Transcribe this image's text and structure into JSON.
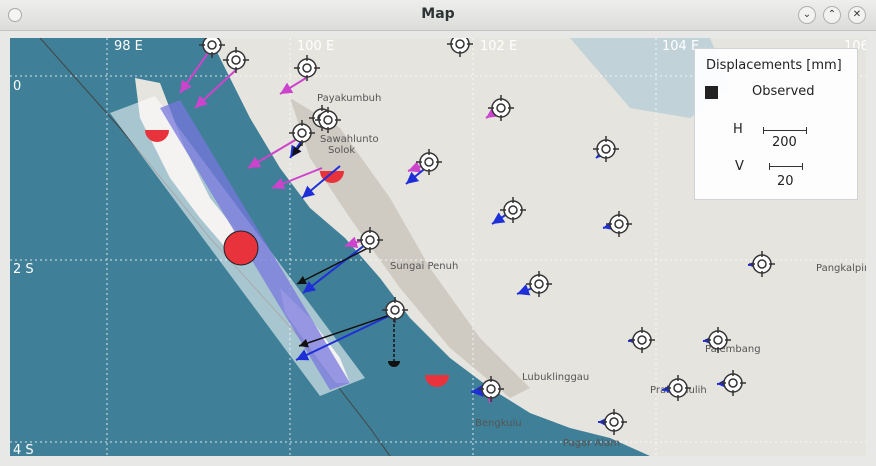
{
  "window": {
    "title": "Map"
  },
  "titlebar_icons": [
    "minimize-icon",
    "maximize-icon",
    "close-icon"
  ],
  "axes": {
    "lon_labels": [
      "98 E",
      "100 E",
      "102 E",
      "104 E",
      "106"
    ],
    "lat_labels": [
      "0",
      "2 S",
      "4 S"
    ]
  },
  "places": [
    "Payakumbuh",
    "Sawahlunto",
    "Solok",
    "Sungai Penuh",
    "Lubuklinggau",
    "Bengkulu",
    "Pagar Alam",
    "Palembang",
    "Prabumulih",
    "Pangkalpin"
  ],
  "legend": {
    "title": "Displacements [mm]",
    "observed_label": "Observed",
    "h_label": "H",
    "h_value": "200",
    "v_label": "V",
    "v_value": "20"
  },
  "colors": {
    "sea": "#3f8098",
    "land": "#e6e4df",
    "modeled_arrow": "#cc44cc",
    "observed_arrow": "#1f2fd8",
    "fault_patch": "#7777dd",
    "source_marker": "#e8323c"
  }
}
